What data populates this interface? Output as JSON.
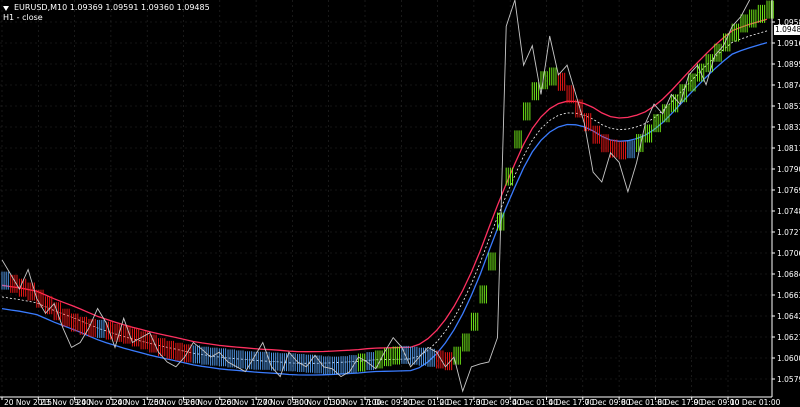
{
  "header": {
    "symbol_line": "EURUSD,M10  1.09369 1.09591 1.09360 1.09485",
    "indicator_line": "H1 - close"
  },
  "current_price": "1.09485",
  "price_axis": [
    "1.09580",
    "1.09160",
    "1.08950",
    "1.08740",
    "1.08530",
    "1.08320",
    "1.08110",
    "1.07900",
    "1.07690",
    "1.07480",
    "1.07270",
    "1.07060",
    "1.06845",
    "1.06635",
    "1.06425",
    "1.06215",
    "1.06005",
    "1.05795"
  ],
  "time_axis": [
    "20 Nov 2015",
    "23 Nov 09:00",
    "24 Nov 01:00",
    "24 Nov 17:00",
    "25 Nov 09:00",
    "26 Nov 01:00",
    "26 Nov 17:00",
    "27 Nov 09:00",
    "30 Nov 01:00",
    "30 Nov 17:00",
    "1 Dec 09:00",
    "2 Dec 01:00",
    "2 Dec 17:00",
    "3 Dec 09:00",
    "4 Dec 01:00",
    "4 Dec 17:00",
    "7 Dec 09:00",
    "8 Dec 01:00",
    "8 Dec 17:00",
    "9 Dec 09:00",
    "10 Dec 01:00"
  ],
  "colors": {
    "background": "#000000",
    "grid": "#2a2a2a",
    "price_line": "#c8c8c8",
    "band_upper": "#ff3060",
    "band_lower": "#3a7cff",
    "band_mid": "#ffffff",
    "hist_up": "#7cff1a",
    "hist_down": "#ff1a1a",
    "hist_neutral": "#5aa8ff"
  },
  "chart_data": {
    "type": "line",
    "ylim": [
      1.0569,
      1.0977
    ],
    "x": [
      0,
      5,
      10,
      15,
      20,
      25,
      30,
      35,
      40,
      45,
      50,
      55,
      60,
      65,
      70,
      75,
      80,
      85,
      90,
      95,
      100
    ],
    "series": [
      {
        "values": [
          1.071,
          1.0695,
          1.068,
          1.07,
          1.067,
          1.0655,
          1.0665,
          1.064,
          1.062,
          1.0625,
          1.064,
          1.066,
          1.0645,
          1.062,
          1.065,
          1.0625,
          1.063,
          1.0635,
          1.0615,
          1.0605,
          1.06,
          1.061,
          1.0625,
          1.0618,
          1.061,
          1.0615,
          1.0605,
          1.06,
          1.0595,
          1.061,
          1.0625,
          1.06,
          1.059,
          1.0615,
          1.0605,
          1.06,
          1.0612,
          1.06,
          1.0598,
          1.059,
          1.0595,
          1.061,
          1.0605,
          1.0598,
          1.0615,
          1.063,
          1.062,
          1.06,
          1.061,
          1.062,
          1.0615,
          1.06,
          1.061,
          1.0575,
          1.06,
          1.0603,
          1.0605,
          1.063,
          1.095,
          1.0977,
          1.091,
          1.093,
          1.088,
          1.094,
          1.09,
          1.091,
          1.088,
          1.085,
          1.08,
          1.079,
          1.082,
          1.081,
          1.078,
          1.081,
          1.085,
          1.087,
          1.086,
          1.088,
          1.087,
          1.09,
          1.091,
          1.089,
          1.092,
          1.093,
          1.095,
          1.096,
          1.0977,
          1.099,
          1.0977
        ]
      }
    ]
  }
}
